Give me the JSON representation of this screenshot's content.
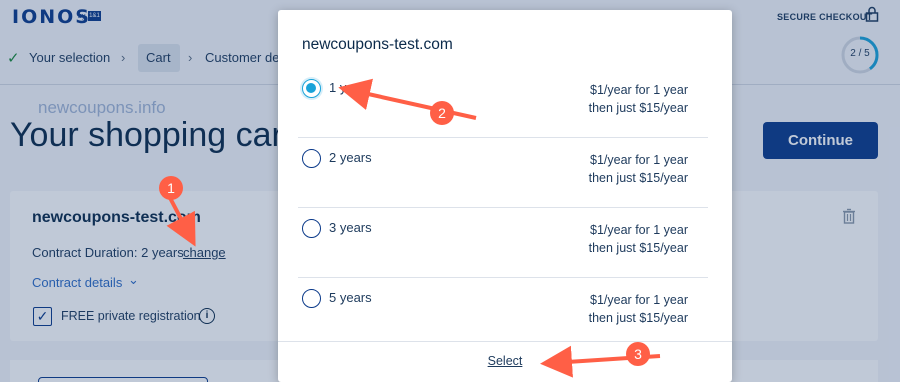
{
  "header": {
    "logo": "IONOS",
    "logo_by": "by",
    "logo_mark": "1&1",
    "secure_checkout": "SECURE CHECKOUT",
    "lock_icon": "lock-icon"
  },
  "steps": {
    "items": [
      "Your selection",
      "Cart",
      "Customer de"
    ],
    "progress": "2 / 5"
  },
  "watermark": "newcoupons.info",
  "page": {
    "title": "Your shopping cart",
    "continue_label": "Continue"
  },
  "cart_item": {
    "domain": "newcoupons-test.com",
    "contract_duration": "Contract Duration: 2 years",
    "change_label": "change",
    "contract_details_label": "Contract details",
    "free_private_reg_label": "FREE private registration",
    "info_icon": "info-icon",
    "trash_icon": "trash-icon"
  },
  "modal": {
    "title": "newcoupons-test.com",
    "options": [
      {
        "label": "1 year",
        "price_line1": "$1/year for 1 year",
        "price_line2": "then just $15/year",
        "selected": true
      },
      {
        "label": "2 years",
        "price_line1": "$1/year for 1 year",
        "price_line2": "then just $15/year",
        "selected": false
      },
      {
        "label": "3 years",
        "price_line1": "$1/year for 1 year",
        "price_line2": "then just $15/year",
        "selected": false
      },
      {
        "label": "5 years",
        "price_line1": "$1/year for 1 year",
        "price_line2": "then just $15/year",
        "selected": false
      }
    ],
    "select_label": "Select"
  },
  "annotations": {
    "badges": [
      "1",
      "2",
      "3"
    ],
    "color": "#ff5f46"
  },
  "colors": {
    "brand": "#0b3a8a",
    "accent": "#1aa3d9",
    "link": "#2f6cc5"
  }
}
